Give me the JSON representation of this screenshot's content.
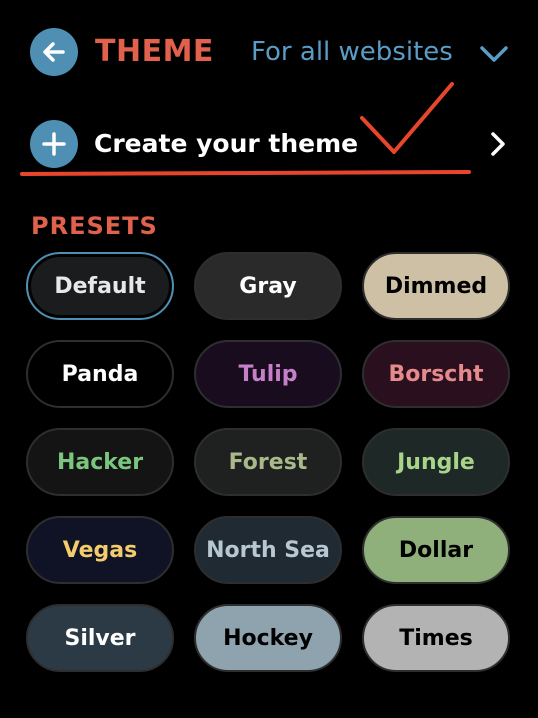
{
  "header": {
    "title": "THEME",
    "scope": "For all websites"
  },
  "create": {
    "label": "Create your theme"
  },
  "presets": {
    "heading": "PRESETS",
    "items": [
      {
        "label": "Default",
        "bg": "#1b1c1e",
        "fg": "#e8e8e8",
        "selected": true
      },
      {
        "label": "Gray",
        "bg": "#2a2a2a",
        "fg": "#ffffff"
      },
      {
        "label": "Dimmed",
        "bg": "#cdc0a5",
        "fg": "#000000"
      },
      {
        "label": "Panda",
        "bg": "#000000",
        "fg": "#ffffff"
      },
      {
        "label": "Tulip",
        "bg": "#1a0c1f",
        "fg": "#c67fc9"
      },
      {
        "label": "Borscht",
        "bg": "#2a0f1f",
        "fg": "#e58b8b"
      },
      {
        "label": "Hacker",
        "bg": "#141414",
        "fg": "#7bc67e"
      },
      {
        "label": "Forest",
        "bg": "#1e2120",
        "fg": "#a9b98a"
      },
      {
        "label": "Jungle",
        "bg": "#1e2826",
        "fg": "#a8d48a"
      },
      {
        "label": "Vegas",
        "bg": "#101326",
        "fg": "#f3cc6b"
      },
      {
        "label": "North Sea",
        "bg": "#202a33",
        "fg": "#b7c8d3"
      },
      {
        "label": "Dollar",
        "bg": "#8fb07a",
        "fg": "#000000"
      },
      {
        "label": "Silver",
        "bg": "#2b3a44",
        "fg": "#ffffff"
      },
      {
        "label": "Hockey",
        "bg": "#8ea3ad",
        "fg": "#000000"
      },
      {
        "label": "Times",
        "bg": "#b3b3b3",
        "fg": "#000000"
      }
    ]
  },
  "colors": {
    "accent": "#e0614c",
    "blue": "#4e8fb3",
    "link": "#5a9cc6",
    "background": "#000000"
  },
  "icons": {
    "back": "arrow-left-icon",
    "scope": "chevron-down-icon",
    "create": "plus-icon",
    "create_arrow": "chevron-right-icon"
  }
}
